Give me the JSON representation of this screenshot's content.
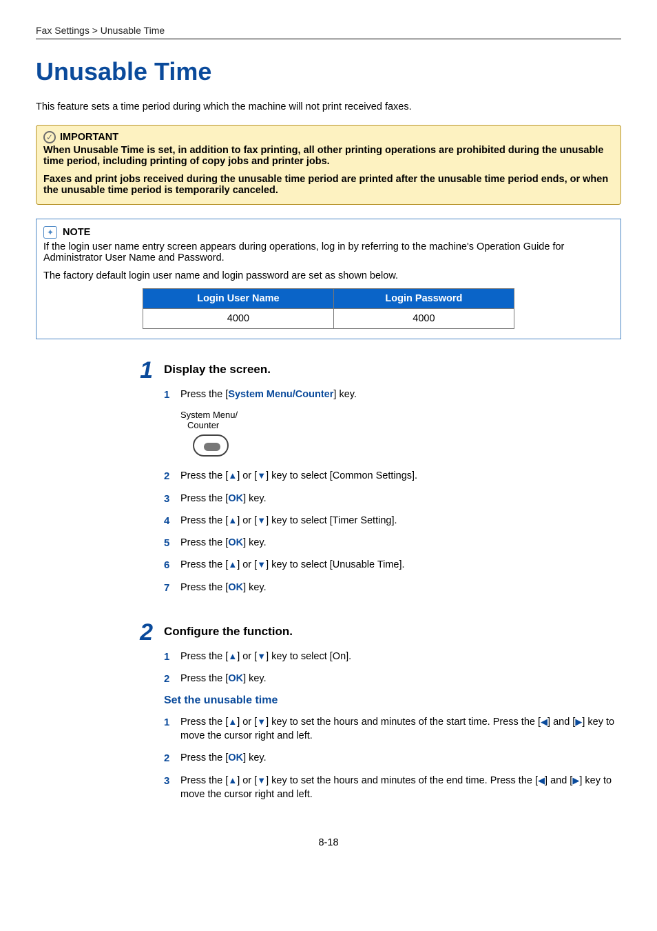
{
  "breadcrumb": "Fax Settings > Unusable Time",
  "title": "Unusable Time",
  "intro": "This feature sets a time period during which the machine will not print received faxes.",
  "important": {
    "label": "IMPORTANT",
    "p1": "When Unusable Time is set, in addition to fax printing, all other printing operations are prohibited during the unusable time period, including printing of copy jobs and printer jobs.",
    "p2": "Faxes and print jobs received during the unusable time period are printed after the unusable time period ends, or when the unusable time period is temporarily canceled."
  },
  "note": {
    "label": "NOTE",
    "p1": "If the login user name entry screen appears during operations, log in by referring to the machine's Operation Guide for Administrator User Name and Password.",
    "p2": "The factory default login user name and login password are set as shown below.",
    "table": {
      "h1": "Login User Name",
      "h2": "Login Password",
      "v1": "4000",
      "v2": "4000"
    }
  },
  "step1": {
    "num": "1",
    "title": "Display the screen.",
    "items": {
      "s1": {
        "n": "1",
        "pre": "Press the [",
        "key": "System Menu/Counter",
        "post": "] key."
      },
      "btn": {
        "l1": "System Menu/",
        "l2": "Counter"
      },
      "s2": {
        "n": "2",
        "pre": "Press the [",
        "or": "] or [",
        "post": "] key to select [Common Settings]."
      },
      "s3": {
        "n": "3",
        "pre": "Press the [",
        "key": "OK",
        "post": "] key."
      },
      "s4": {
        "n": "4",
        "pre": "Press the [",
        "or": "] or [",
        "post": "] key to select [Timer Setting]."
      },
      "s5": {
        "n": "5",
        "pre": "Press the [",
        "key": "OK",
        "post": "] key."
      },
      "s6": {
        "n": "6",
        "pre": "Press the [",
        "or": "] or [",
        "post": "] key to select [Unusable Time]."
      },
      "s7": {
        "n": "7",
        "pre": "Press the [",
        "key": "OK",
        "post": "] key."
      }
    }
  },
  "step2": {
    "num": "2",
    "title": "Configure the function.",
    "items": {
      "s1": {
        "n": "1",
        "pre": "Press the [",
        "or": "] or [",
        "post": "] key to select [On]."
      },
      "s2": {
        "n": "2",
        "pre": "Press the [",
        "key": "OK",
        "post": "] key."
      }
    },
    "subhead": "Set the unusable time",
    "items2": {
      "s1": {
        "n": "1",
        "pre": "Press the [",
        "or": "] or [",
        "mid": "] key to set the hours and minutes of the start time. Press the [",
        "and": "] and [",
        "post": "] key to move the cursor right and left."
      },
      "s2": {
        "n": "2",
        "pre": "Press the [",
        "key": "OK",
        "post": "] key."
      },
      "s3": {
        "n": "3",
        "pre": "Press the [",
        "or": "] or [",
        "mid": "] key to set the hours and minutes of the end time. Press the [",
        "and": "] and [",
        "post": "] key to move the cursor right and left."
      }
    }
  },
  "pagenum": "8-18"
}
